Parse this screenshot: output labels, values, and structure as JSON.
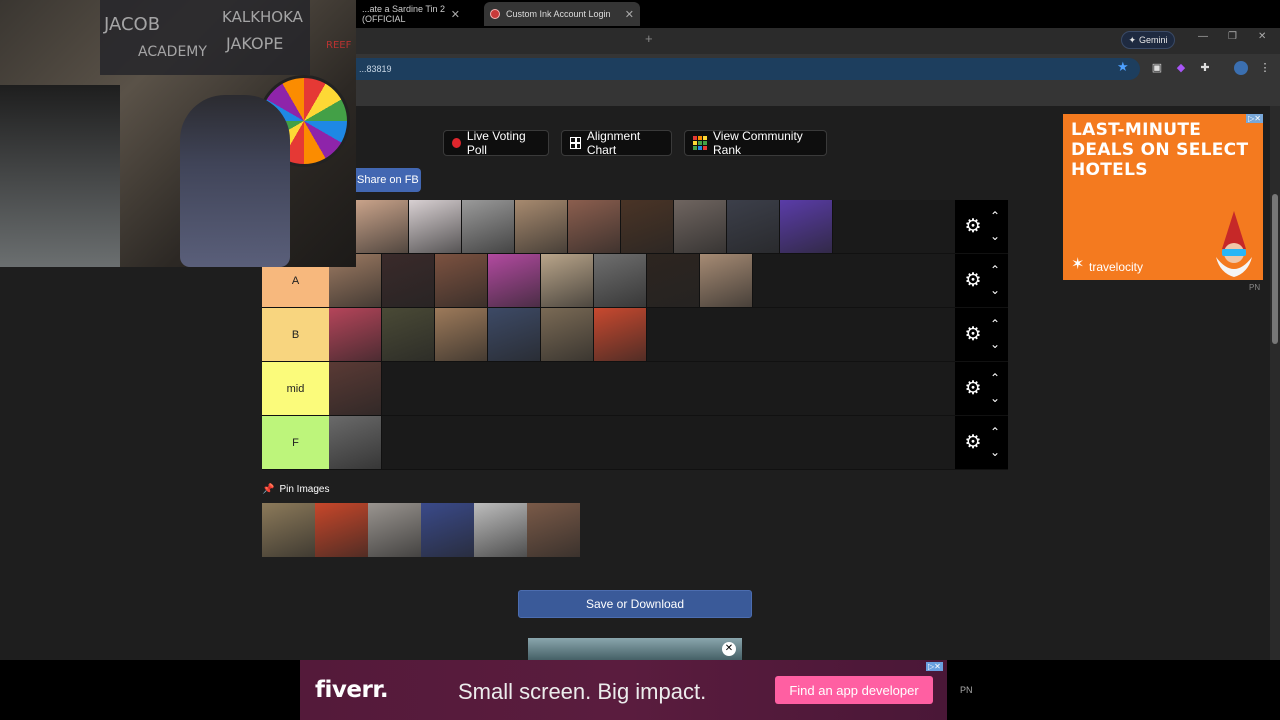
{
  "browser": {
    "tabs": [
      {
        "label": "...ate a Sardine Tin 2 (OFFICIAL"
      },
      {
        "label": "Custom Ink Account Login"
      }
    ],
    "new_tab": "+",
    "gemini_label": "Gemini",
    "address": "...83819",
    "window_controls": [
      "—",
      "❐",
      "✕"
    ]
  },
  "webcam": {
    "board_text_1": "JACOB",
    "board_text_2": "KALKHOKA",
    "board_text_3": "ACADEMY",
    "board_text_4": "JAKOPE",
    "board_text_5": "REEF"
  },
  "toolbar": {
    "live_voting": "Live Voting Poll",
    "alignment_chart": "Alignment Chart",
    "community_rank": "View Community Rank",
    "share_fb": "Share on FB"
  },
  "tiers": [
    {
      "label": "",
      "color": "#1e1e1e",
      "items": [
        "#c9a38a",
        "#d8d0d2",
        "#9a9a9a",
        "#a78a6f",
        "#8b5e4e",
        "#4a3426",
        "#6f6560",
        "#3c3f4a",
        "#5a3ca8"
      ]
    },
    {
      "label": "A",
      "color": "#f7b87d",
      "items": [
        "#9c7a62",
        "#3a2a2a",
        "#7c5240",
        "#b24aa0",
        "#b9a58a",
        "#6f6f6f",
        "#2d2520",
        "#a68b74"
      ]
    },
    {
      "label": "B",
      "color": "#f8d57f",
      "items": [
        "#b5455a",
        "#4a4a36",
        "#9d7a5a",
        "#3d4a66",
        "#7a6a55",
        "#c8492f"
      ]
    },
    {
      "label": "mid",
      "color": "#fbfb7b",
      "items": [
        "#5a3a35"
      ]
    },
    {
      "label": "F",
      "color": "#bdf57b",
      "items": [
        "#6a6a6a"
      ]
    }
  ],
  "pin": {
    "label": "Pin Images",
    "items": [
      "#8c7a5a",
      "#c8472a",
      "#9a9590",
      "#3a4a8a",
      "#bdbdbd",
      "#7a5a48"
    ]
  },
  "save_button": "Save or Download",
  "right_ad": {
    "headline": "LAST-MINUTE DEALS ON SELECT HOTELS",
    "brand": "travelocity",
    "badge": "PN"
  },
  "bottom_ad": {
    "logo": "fiverr.",
    "tagline": "Small screen. Big impact.",
    "cta": "Find an app developer",
    "badge": "PN"
  }
}
